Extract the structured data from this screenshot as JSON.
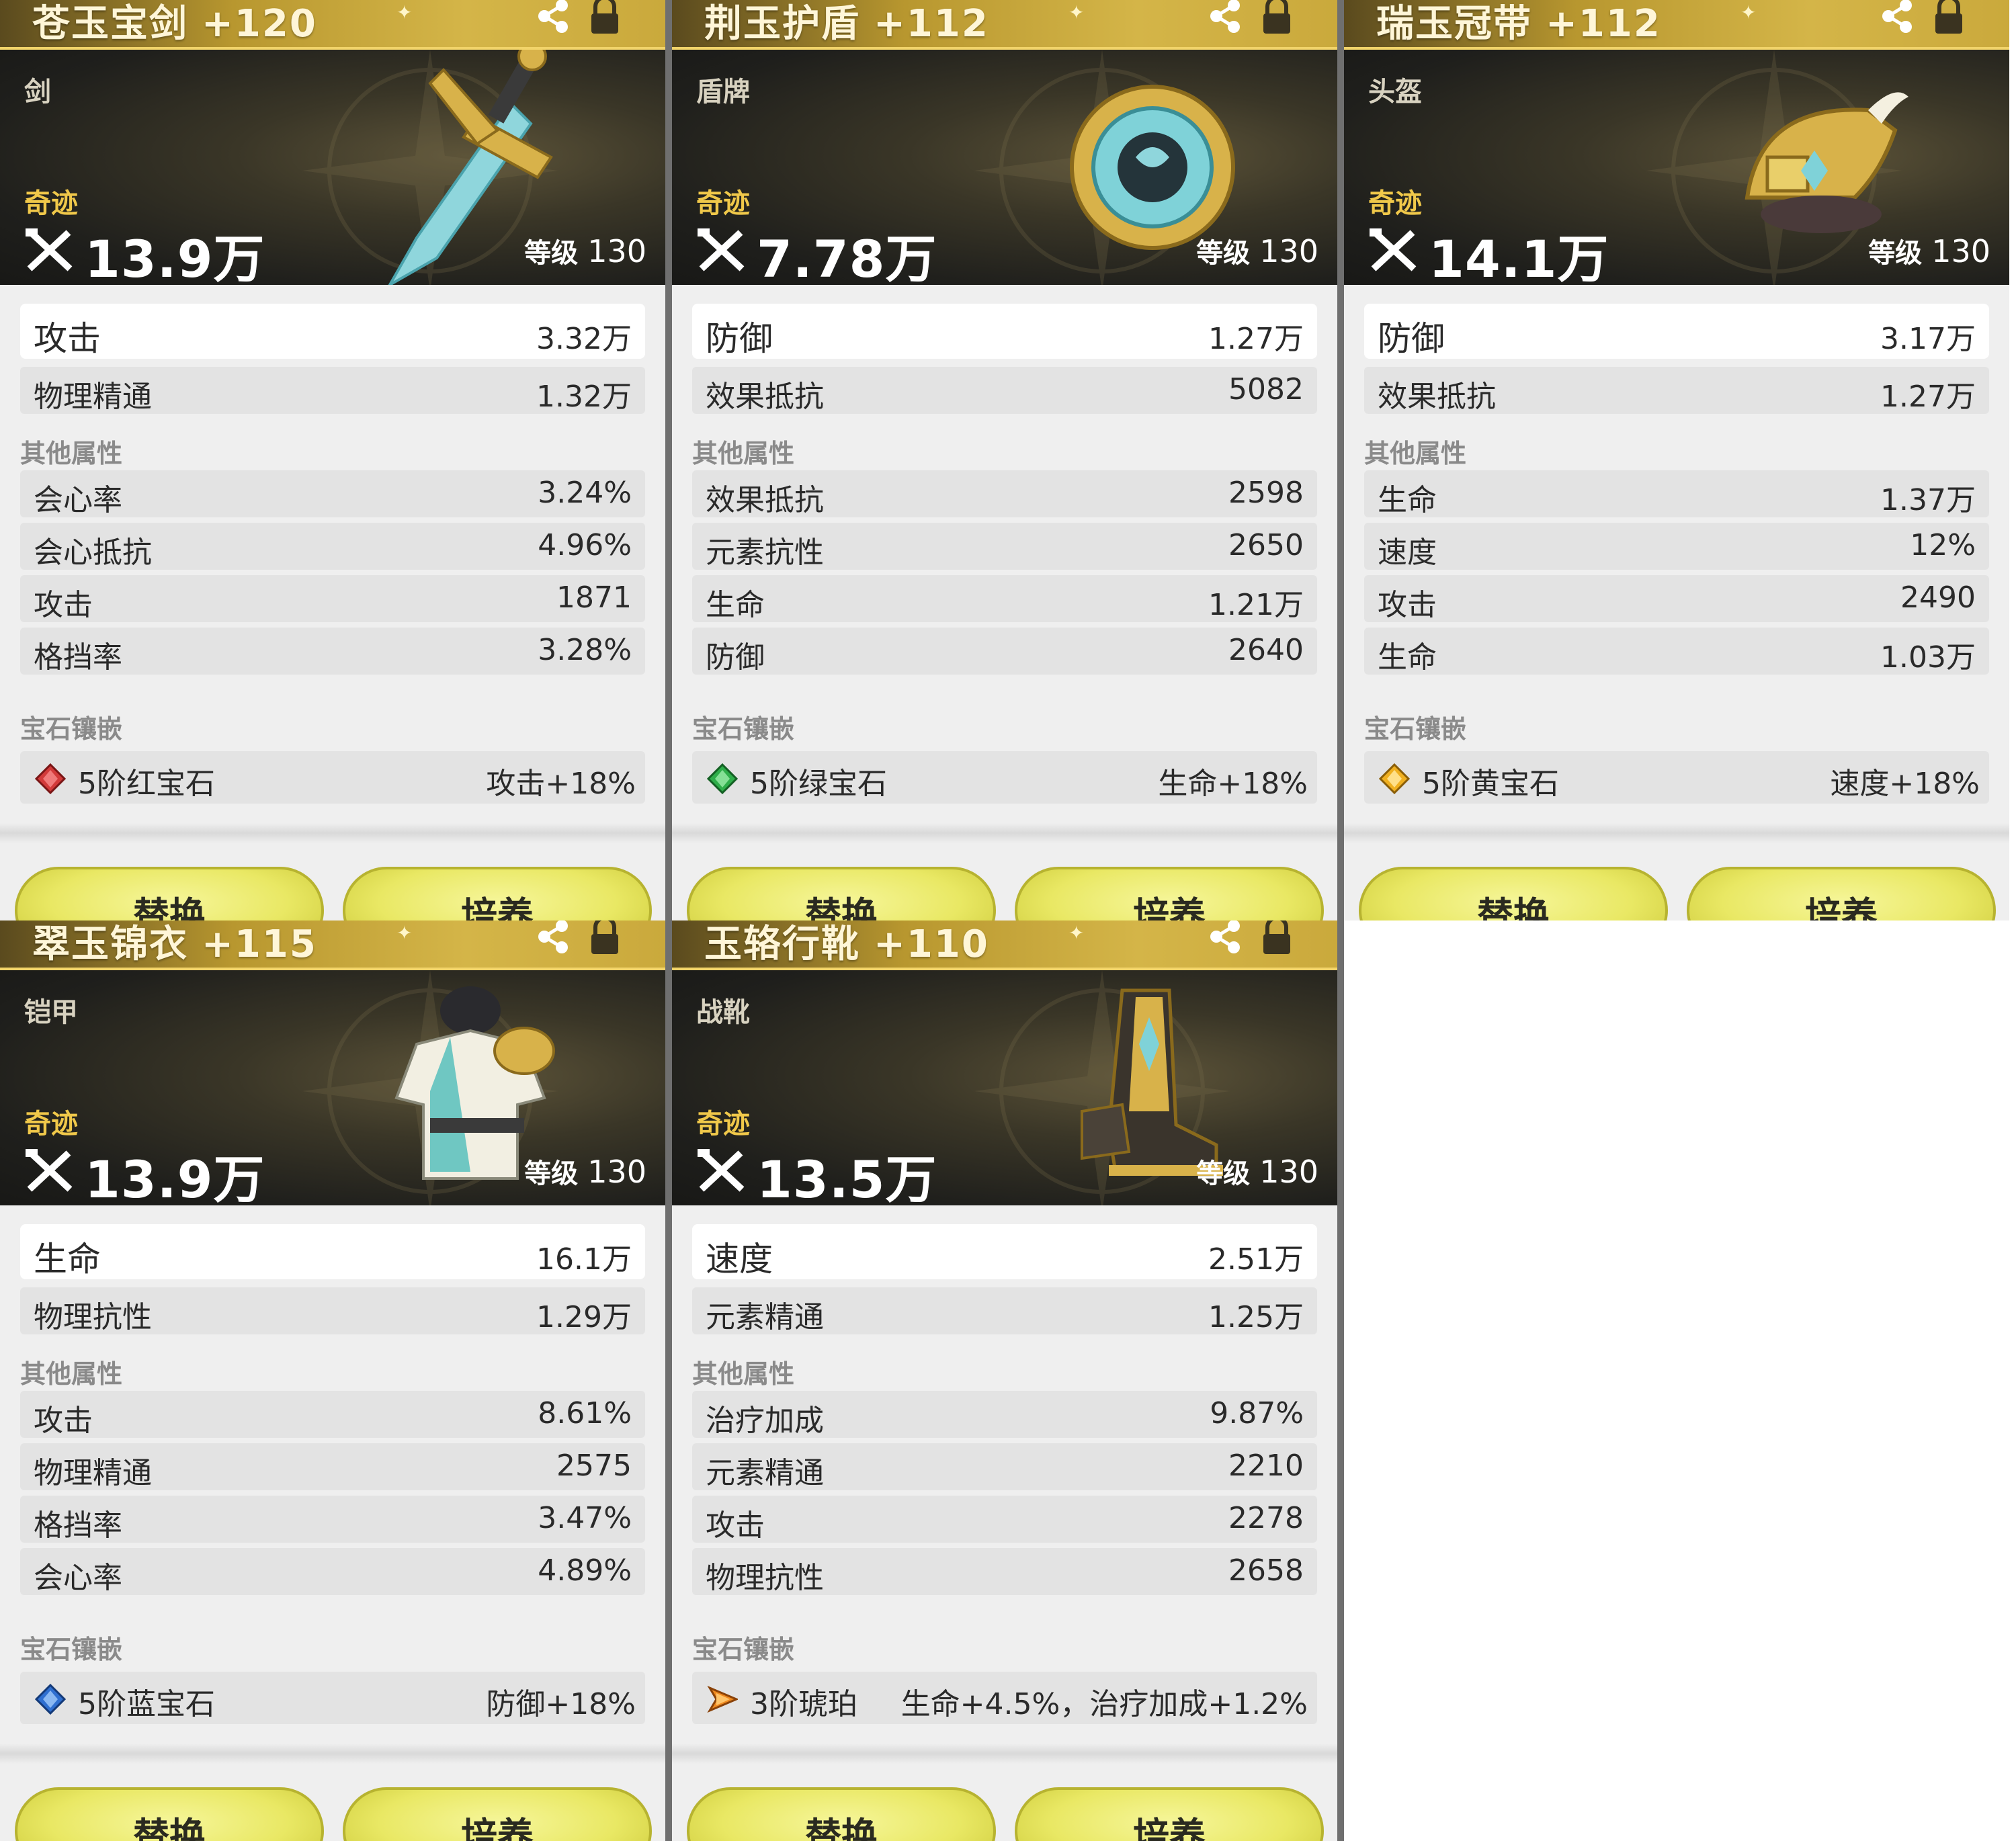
{
  "colors": {
    "title_gold": "#b8972f",
    "rarity_gold": "#f0c84a",
    "hero_dark": "#1f1f1c",
    "button_yellow": "#e9e864",
    "panel_bg": "#efefef"
  },
  "icons": {
    "share": "share-icon",
    "lock": "lock-icon",
    "power": "crossed-swords-icon",
    "gem": "gem-icon"
  },
  "labels": {
    "other_attrs": "其他属性",
    "gems": "宝石镶嵌",
    "level": "等级",
    "replace": "替换",
    "upgrade": "培养"
  },
  "cards": [
    {
      "name": "苍玉宝剑",
      "enhance": "+120",
      "type": "剑",
      "rarity": "奇迹",
      "power": "13.9万",
      "level": "130",
      "main_stats": [
        {
          "label": "攻击",
          "value": "3.32万"
        },
        {
          "label": "物理精通",
          "value": "1.32万"
        }
      ],
      "other_stats": [
        {
          "label": "会心率",
          "value": "3.24%"
        },
        {
          "label": "会心抵抗",
          "value": "4.96%"
        },
        {
          "label": "攻击",
          "value": "1871"
        },
        {
          "label": "格挡率",
          "value": "3.28%"
        }
      ],
      "gem": {
        "name": "5阶红宝石",
        "bonus": "攻击+18%",
        "color": "#d23a3a"
      }
    },
    {
      "name": "荆玉护盾",
      "enhance": "+112",
      "type": "盾牌",
      "rarity": "奇迹",
      "power": "7.78万",
      "level": "130",
      "main_stats": [
        {
          "label": "防御",
          "value": "1.27万"
        },
        {
          "label": "效果抵抗",
          "value": "5082"
        }
      ],
      "other_stats": [
        {
          "label": "效果抵抗",
          "value": "2598"
        },
        {
          "label": "元素抗性",
          "value": "2650"
        },
        {
          "label": "生命",
          "value": "1.21万"
        },
        {
          "label": "防御",
          "value": "2640"
        }
      ],
      "gem": {
        "name": "5阶绿宝石",
        "bonus": "生命+18%",
        "color": "#2fae4a"
      }
    },
    {
      "name": "瑞玉冠带",
      "enhance": "+112",
      "type": "头盔",
      "rarity": "奇迹",
      "power": "14.1万",
      "level": "130",
      "main_stats": [
        {
          "label": "防御",
          "value": "3.17万"
        },
        {
          "label": "效果抵抗",
          "value": "1.27万"
        }
      ],
      "other_stats": [
        {
          "label": "生命",
          "value": "1.37万"
        },
        {
          "label": "速度",
          "value": "12%"
        },
        {
          "label": "攻击",
          "value": "2490"
        },
        {
          "label": "生命",
          "value": "1.03万"
        }
      ],
      "gem": {
        "name": "5阶黄宝石",
        "bonus": "速度+18%",
        "color": "#f0b020"
      }
    },
    {
      "name": "翠玉锦衣",
      "enhance": "+115",
      "type": "铠甲",
      "rarity": "奇迹",
      "power": "13.9万",
      "level": "130",
      "main_stats": [
        {
          "label": "生命",
          "value": "16.1万"
        },
        {
          "label": "物理抗性",
          "value": "1.29万"
        }
      ],
      "other_stats": [
        {
          "label": "攻击",
          "value": "8.61%"
        },
        {
          "label": "物理精通",
          "value": "2575"
        },
        {
          "label": "格挡率",
          "value": "3.47%"
        },
        {
          "label": "会心率",
          "value": "4.89%"
        }
      ],
      "gem": {
        "name": "5阶蓝宝石",
        "bonus": "防御+18%",
        "color": "#2f6fd0"
      }
    },
    {
      "name": "玉辂行靴",
      "enhance": "+110",
      "type": "战靴",
      "rarity": "奇迹",
      "power": "13.5万",
      "level": "130",
      "main_stats": [
        {
          "label": "速度",
          "value": "2.51万"
        },
        {
          "label": "元素精通",
          "value": "1.25万"
        }
      ],
      "other_stats": [
        {
          "label": "治疗加成",
          "value": "9.87%"
        },
        {
          "label": "元素精通",
          "value": "2210"
        },
        {
          "label": "攻击",
          "value": "2278"
        },
        {
          "label": "物理抗性",
          "value": "2658"
        }
      ],
      "gem": {
        "name": "3阶琥珀",
        "bonus": "生命+4.5%，治疗加成+1.2%",
        "color": "#f08a20"
      }
    }
  ]
}
